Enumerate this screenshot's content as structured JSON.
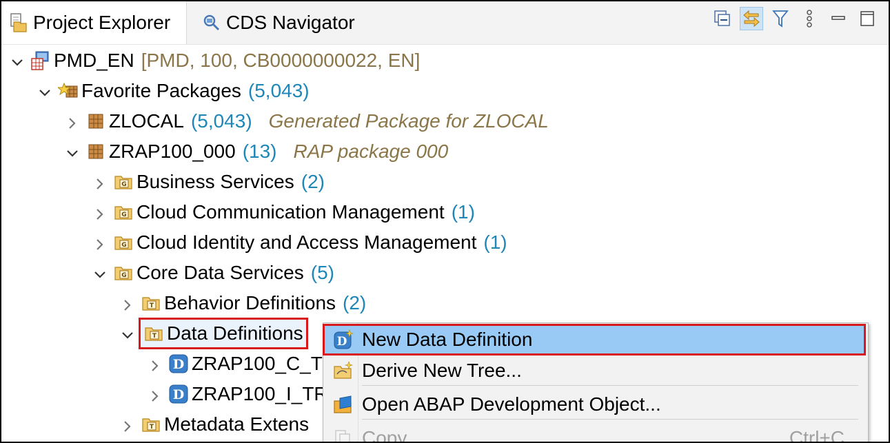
{
  "tabs": {
    "project_explorer": "Project Explorer",
    "cds_navigator": "CDS Navigator"
  },
  "tree": {
    "project": {
      "name": "PMD_EN",
      "info": "[PMD, 100, CB0000000022, EN]"
    },
    "favorites": {
      "name": "Favorite Packages",
      "count": "(5,043)"
    },
    "zlocal": {
      "name": "ZLOCAL",
      "count": "(5,043)",
      "desc": "Generated Package for ZLOCAL"
    },
    "zrap": {
      "name": "ZRAP100_000",
      "count": "(13)",
      "desc": "RAP package 000"
    },
    "business_services": {
      "name": "Business Services",
      "count": "(2)"
    },
    "cloud_comm": {
      "name": "Cloud Communication Management",
      "count": "(1)"
    },
    "cloud_identity": {
      "name": "Cloud Identity and Access Management",
      "count": "(1)"
    },
    "core_data": {
      "name": "Core Data Services",
      "count": "(5)"
    },
    "behavior_defs": {
      "name": "Behavior Definitions",
      "count": "(2)"
    },
    "data_defs": {
      "name": "Data Definitions"
    },
    "ddl_c": {
      "name": "ZRAP100_C_T"
    },
    "ddl_i": {
      "name": "ZRAP100_I_TR"
    },
    "metadata_ext": {
      "name": "Metadata Extens"
    }
  },
  "context_menu": {
    "new_data_definition": "New Data Definition",
    "derive_new_tree": "Derive New Tree...",
    "open_abap_object": "Open ABAP Development Object...",
    "copy": "Copy",
    "copy_shortcut": "Ctrl+C"
  },
  "colors": {
    "count": "#1f86b8",
    "description": "#8a7648",
    "selection": "#99c9f5",
    "highlight_border": "#d7191c"
  },
  "icons": {
    "project_explorer": "project-explorer-icon",
    "cds_navigator": "cds-navigator-icon",
    "collapse_all": "collapse-all-icon",
    "link_with_editor": "link-with-editor-icon",
    "filter": "filter-icon",
    "view_menu": "view-menu-icon",
    "maximize": "maximize-icon"
  }
}
